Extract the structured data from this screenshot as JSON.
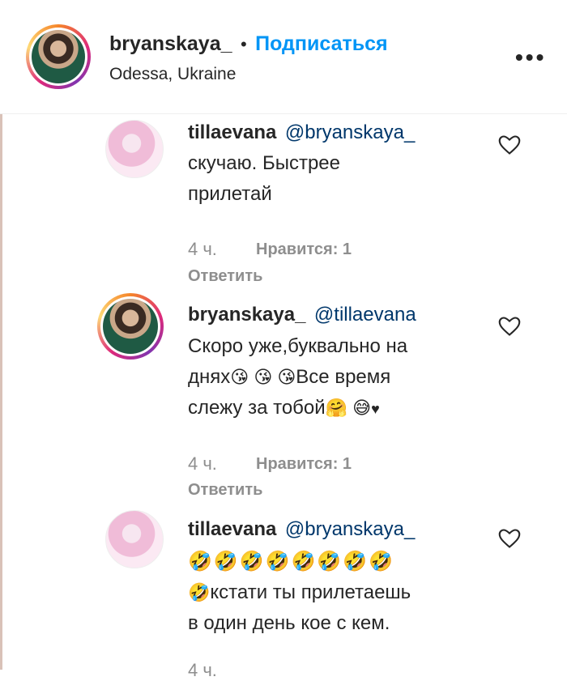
{
  "header": {
    "username": "bryanskaya_",
    "separator": "•",
    "follow_label": "Подписаться",
    "location": "Odessa, Ukraine",
    "more_icon": "more-horizontal-icon"
  },
  "comments": [
    {
      "user": "tillaevana",
      "mention": "@bryanskaya_",
      "lines": [
        "скучаю. Быстрее",
        "прилетай"
      ],
      "time": "4 ч.",
      "likes": "Нравится: 1",
      "reply": "Ответить"
    },
    {
      "user": "bryanskaya_",
      "mention": "@tillaevana",
      "line1": "Скоро уже,буквально на",
      "line2_text": "днях",
      "line2_emojis": "😘 😘 😘",
      "line2_after": "Все время",
      "line3_text": "слежу за тобой",
      "line3_emojis": "🤗 😅",
      "line3_heart": "♥",
      "time": "4 ч.",
      "likes": "Нравится: 1",
      "reply": "Ответить"
    },
    {
      "user": "tillaevana",
      "mention": "@bryanskaya_",
      "emoji_row": "🤣🤣🤣🤣🤣🤣🤣🤣",
      "line2_emoji": "🤣",
      "line2_text": "кстати ты прилетаешь",
      "line3": "в один день кое с кем.",
      "time": "4 ч."
    }
  ],
  "colors": {
    "link": "#0095f6",
    "mention": "#00376b",
    "muted": "#8e8e8e"
  }
}
